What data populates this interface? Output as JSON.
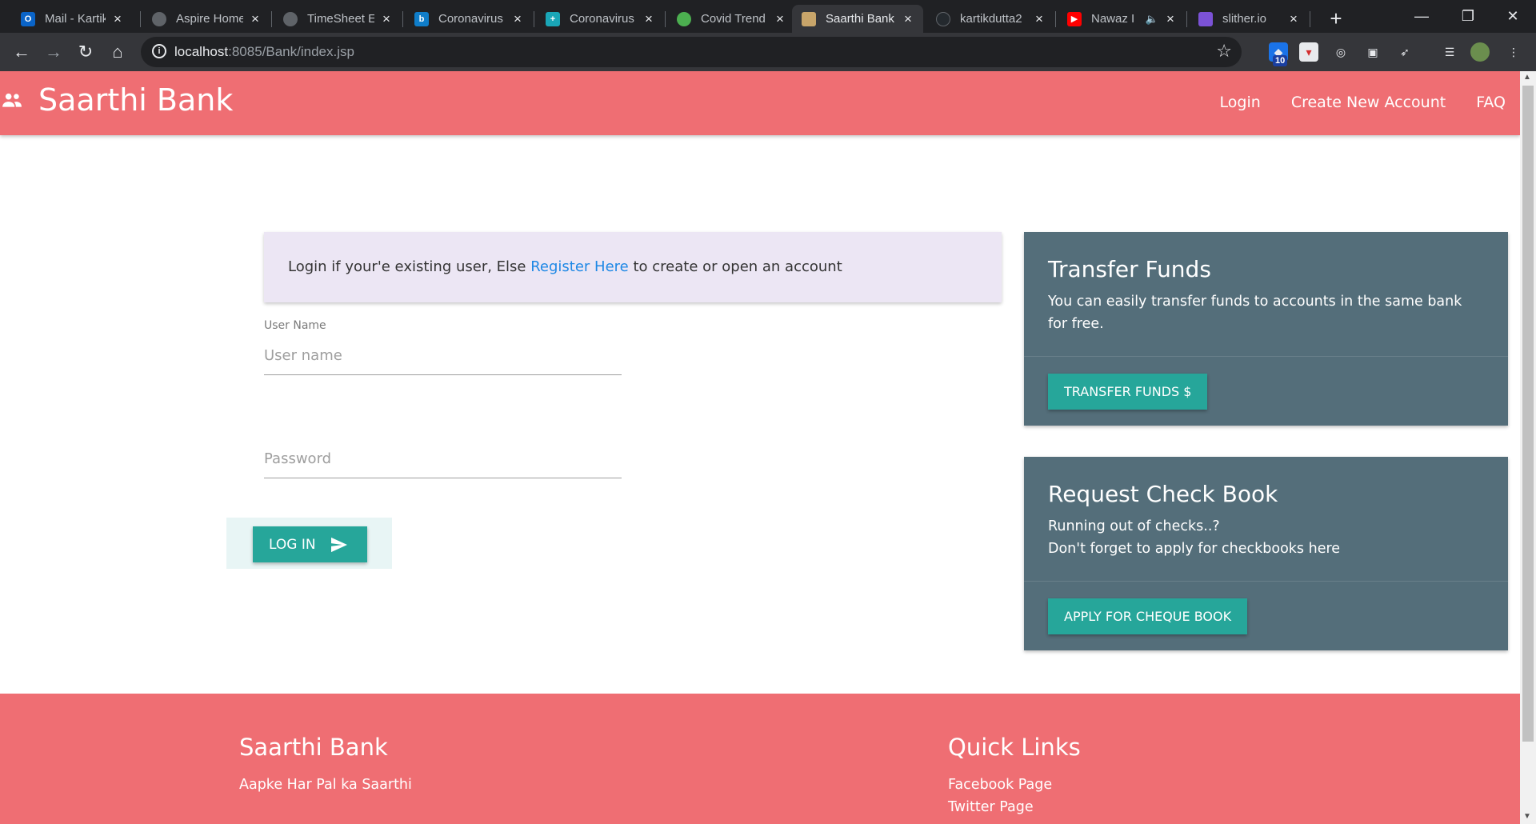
{
  "browser": {
    "tabs": [
      {
        "title": "Mail - Kartik",
        "icon": "outlook-icon",
        "color": "#0a64c8"
      },
      {
        "title": "Aspire Home",
        "icon": "globe-icon",
        "color": "#5f6368"
      },
      {
        "title": "TimeSheet E",
        "icon": "globe-icon",
        "color": "#5f6368"
      },
      {
        "title": "Coronavirus",
        "icon": "bing-icon",
        "color": "#0f7dc9"
      },
      {
        "title": "Coronavirus",
        "icon": "hospital-icon",
        "color": "#1aa6b7"
      },
      {
        "title": "Covid Trend",
        "icon": "virus-icon",
        "color": "#4caf50"
      },
      {
        "title": "Saarthi Bank",
        "icon": "bank-favicon-icon",
        "color": "#c8a56a"
      },
      {
        "title": "kartikdutta2",
        "icon": "github-icon",
        "color": "#24292e"
      },
      {
        "title": "Nawaz I",
        "icon": "youtube-icon",
        "color": "#ff0000"
      },
      {
        "title": "slither.io",
        "icon": "slither-icon",
        "color": "#7b52d6"
      }
    ],
    "active_tab_index": 6,
    "url_host": "localhost",
    "url_rest": ":8085/Bank/index.jsp",
    "extension_badge": "10"
  },
  "navbar": {
    "brand": "Saarthi Bank",
    "links": [
      "Login",
      "Create New Account",
      "FAQ"
    ]
  },
  "info": {
    "prefix": "Login if your'e existing user, Else ",
    "link": "Register Here",
    "suffix": " to create or open an account"
  },
  "form": {
    "username_label": "User Name",
    "username_placeholder": "User name",
    "password_placeholder": "Password",
    "login_label": "LOG IN"
  },
  "cards": {
    "transfer": {
      "title": "Transfer Funds",
      "text": "You can easily transfer funds to accounts in the same bank for free.",
      "button": "TRANSFER FUNDS $"
    },
    "cheque": {
      "title": "Request Check Book",
      "line1": "Running out of checks..?",
      "line2": "Don't forget to apply for checkbooks here",
      "button": "APPLY FOR CHEQUE BOOK"
    }
  },
  "footer": {
    "brand": "Saarthi Bank",
    "tagline": "Aapke Har Pal ka Saarthi",
    "links_title": "Quick Links",
    "links": [
      "Facebook Page",
      "Twitter Page"
    ]
  },
  "colors": {
    "brand": "#ef6e73",
    "teal": "#26a69a",
    "card": "#546e7a"
  }
}
